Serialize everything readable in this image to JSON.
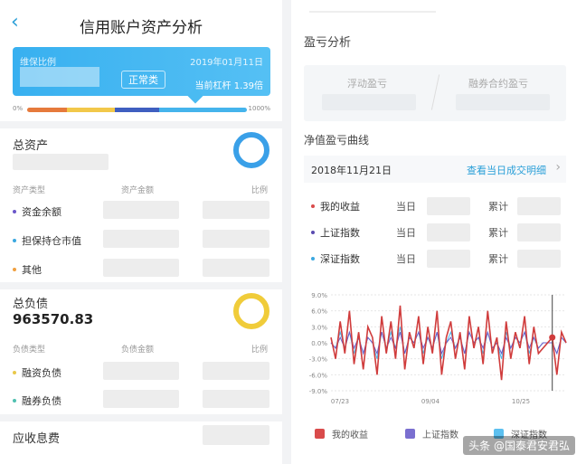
{
  "left": {
    "title": "信用账户资产分析",
    "back_icon": "chevron-left-icon",
    "card": {
      "label": "维保比例",
      "date": "2019年01月11日",
      "badge": "正常类",
      "leverage": "当前杠杆 1.39倍"
    },
    "bar": {
      "min_label": "0%",
      "max_label": "1000%"
    },
    "total_assets": {
      "title": "总资产",
      "col_type": "资产类型",
      "col_amount": "资产金额",
      "col_ratio": "比例",
      "rows": [
        {
          "label": "资金余额",
          "dot_color": "#6b57c9"
        },
        {
          "label": "担保持仓市值",
          "dot_color": "#3aa8e0"
        },
        {
          "label": "其他",
          "dot_color": "#f0a040"
        }
      ]
    },
    "total_liab": {
      "title": "总负债",
      "value": "963570.83",
      "col_type": "负债类型",
      "col_amount": "负债金额",
      "col_ratio": "比例",
      "rows": [
        {
          "label": "融资负债",
          "dot_color": "#e8c84a"
        },
        {
          "label": "融券负债",
          "dot_color": "#4fc0b0"
        }
      ]
    },
    "fees": {
      "title": "应收息费"
    }
  },
  "right": {
    "title": "盈亏分析",
    "float_pl": "浮动盈亏",
    "contract_pl": "融券合约盈亏",
    "curve_title": "净值盈亏曲线",
    "date": "2018年11月21日",
    "link": "查看当日成交明细",
    "legend_rows": [
      {
        "name": "我的收益",
        "color": "#d94b4b",
        "day": "当日",
        "cum": "累计"
      },
      {
        "name": "上证指数",
        "color": "#5a4bb0",
        "day": "当日",
        "cum": "累计"
      },
      {
        "name": "深证指数",
        "color": "#3aa8e0",
        "day": "当日",
        "cum": "累计"
      }
    ],
    "bottom_legend": [
      {
        "name": "我的收益",
        "color": "#d94b4b"
      },
      {
        "name": "上证指数",
        "color": "#7a6fd0"
      },
      {
        "name": "深证指数",
        "color": "#5cc0f0"
      }
    ]
  },
  "chart_data": {
    "type": "line",
    "y_ticks": [
      "9.0%",
      "6.0%",
      "3.0%",
      "0.0%",
      "-3.0%",
      "-6.0%",
      "-9.0%"
    ],
    "x_ticks": [
      "07/23",
      "09/04",
      "10/25"
    ],
    "ylim": [
      -9,
      9
    ],
    "series": [
      {
        "name": "我的收益",
        "color": "#d03c3c",
        "values": [
          1,
          -3,
          4,
          -2,
          6,
          -4,
          2,
          -5,
          3,
          1,
          -6,
          5,
          -2,
          4,
          -3,
          7,
          -5,
          2,
          -1,
          5,
          -4,
          3,
          -2,
          6,
          -6,
          1,
          4,
          -3,
          2,
          -5,
          5,
          -1,
          3,
          -4,
          6,
          -2,
          1,
          -7,
          4,
          -3,
          2,
          -1,
          5,
          -4,
          3,
          -2,
          -1,
          0,
          1,
          -6,
          2,
          0
        ]
      },
      {
        "name": "上证指数",
        "color": "#6a5cc8",
        "values": [
          0,
          -1,
          1,
          -1,
          2,
          -1,
          1,
          -2,
          1,
          0,
          -2,
          2,
          -1,
          1,
          -1,
          2,
          -2,
          1,
          0,
          2,
          -1,
          1,
          -1,
          2,
          -2,
          0,
          1,
          -1,
          1,
          -2,
          2,
          0,
          1,
          -1,
          2,
          -1,
          0,
          -2,
          1,
          -1,
          1,
          0,
          2,
          -1,
          1,
          -1,
          0,
          0,
          0,
          -2,
          1,
          0
        ]
      },
      {
        "name": "深证指数",
        "color": "#4cb6ec",
        "values": [
          0,
          -1,
          2,
          -1,
          2,
          -2,
          1,
          -2,
          1,
          0,
          -3,
          2,
          -1,
          2,
          -1,
          3,
          -2,
          1,
          0,
          2,
          -2,
          1,
          -1,
          2,
          -3,
          0,
          2,
          -1,
          1,
          -2,
          2,
          0,
          1,
          -2,
          2,
          -1,
          0,
          -3,
          2,
          -1,
          1,
          0,
          2,
          -2,
          1,
          -1,
          0,
          0,
          0,
          -2,
          1,
          0
        ]
      }
    ]
  },
  "watermark": "头条 @国泰君安君弘"
}
